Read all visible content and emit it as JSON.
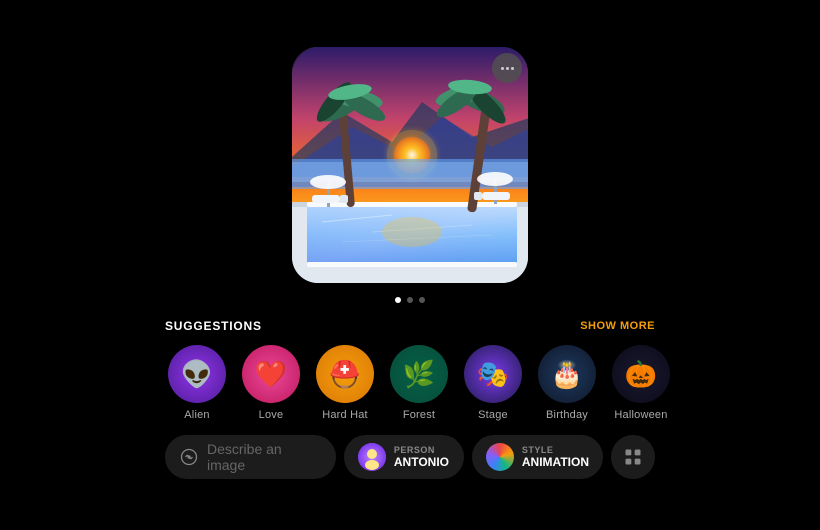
{
  "more_button": "...",
  "pagination": {
    "dots": [
      {
        "active": true
      },
      {
        "active": false
      },
      {
        "active": false
      }
    ]
  },
  "suggestions": {
    "title": "SUGGESTIONS",
    "show_more": "SHOW MORE",
    "items": [
      {
        "id": "alien",
        "label": "Alien",
        "emoji": "👽",
        "bg_class": "alien-bg"
      },
      {
        "id": "love",
        "label": "Love",
        "emoji": "❤️",
        "bg_class": "love-bg"
      },
      {
        "id": "hardhat",
        "label": "Hard Hat",
        "emoji": "⛑️",
        "bg_class": "hardhat-bg"
      },
      {
        "id": "forest",
        "label": "Forest",
        "emoji": "🌿",
        "bg_class": "forest-bg"
      },
      {
        "id": "stage",
        "label": "Stage",
        "emoji": "🎭",
        "bg_class": "stage-bg"
      },
      {
        "id": "birthday",
        "label": "Birthday",
        "emoji": "🎂",
        "bg_class": "birthday-bg"
      },
      {
        "id": "halloween",
        "label": "Halloween",
        "emoji": "🎃",
        "bg_class": "halloween-bg"
      }
    ]
  },
  "toolbar": {
    "describe_placeholder": "Describe an image",
    "person_category": "PERSON",
    "person_value": "ANTONIO",
    "style_category": "STYLE",
    "style_value": "ANIMATION"
  }
}
